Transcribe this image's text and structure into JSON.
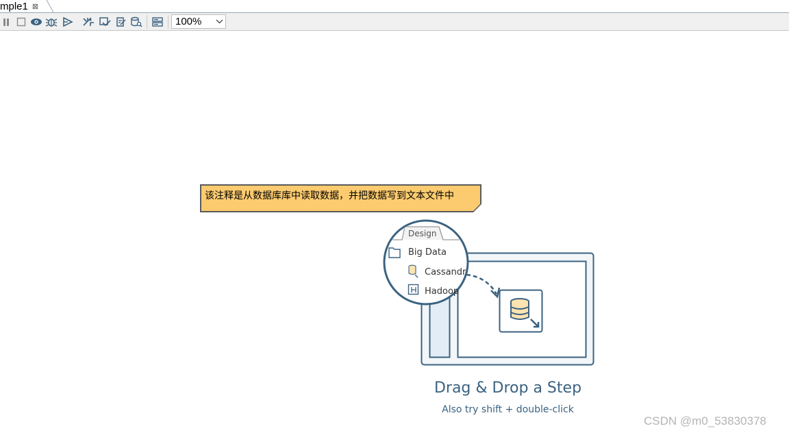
{
  "tab": {
    "title": "mple1",
    "close_glyph": "⊠"
  },
  "toolbar": {
    "buttons": [
      "pause-icon",
      "stop-icon",
      "preview-icon",
      "debug-icon",
      "replay-icon",
      "check-icon",
      "impact-icon",
      "sql-icon",
      "explore-db-icon",
      "layout-icon"
    ],
    "zoom_value": "100%"
  },
  "note": {
    "text": "该注释是从数据库库中读取数据，并把数据写到文本文件中"
  },
  "canvas_hint": {
    "design_tab": "Design",
    "tree_folder": "Big Data",
    "tree_item_1": "Cassandr",
    "tree_item_2": "Hadoop",
    "title": "Drag & Drop a Step",
    "subtitle": "Also try shift + double-click"
  },
  "watermark": "CSDN @m0_53830378",
  "colors": {
    "note_bg": "#fccb6f",
    "illustration": "#3b6280"
  }
}
